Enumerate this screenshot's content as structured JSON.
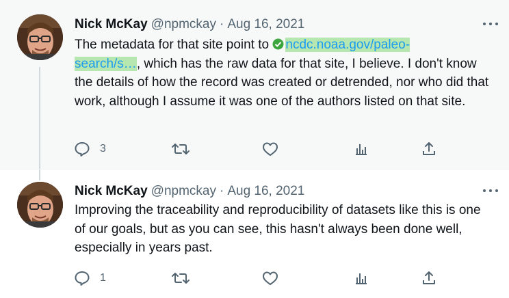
{
  "tweets": [
    {
      "author_name": "Nick McKay",
      "author_handle": "@npmckay",
      "separator": "·",
      "date": "Aug 16, 2021",
      "text_before_link": "The metadata for that site point to ",
      "link_line1": "ncdc.noaa.gov/paleo-",
      "link_line2": "search/s…",
      "text_after_link": ", which has the raw data for that site, I believe. I don't know the details of how the record was created or detrended, nor who did that work, although I assume it was one of the authors listed on that site.",
      "reply_count": "3",
      "retweet_count": "",
      "like_count": "",
      "views_count": ""
    },
    {
      "author_name": "Nick McKay",
      "author_handle": "@npmckay",
      "separator": "·",
      "date": "Aug 16, 2021",
      "text": "Improving the traceability and reproducibility of datasets like this is one of our goals, but as you can see, this hasn't always been done well, especially in years past.",
      "reply_count": "1",
      "retweet_count": "",
      "like_count": "",
      "views_count": ""
    }
  ],
  "colors": {
    "text": "#0f1419",
    "secondary": "#536471",
    "link": "#1d9bf0",
    "link_highlight": "#b6e7b0",
    "verified_badge": "#3ea63e",
    "thread_line": "#cfd9de"
  },
  "icons": [
    "avatar-photo",
    "verified-check-icon",
    "more-icon",
    "reply-icon",
    "retweet-icon",
    "like-icon",
    "views-icon",
    "share-icon"
  ]
}
